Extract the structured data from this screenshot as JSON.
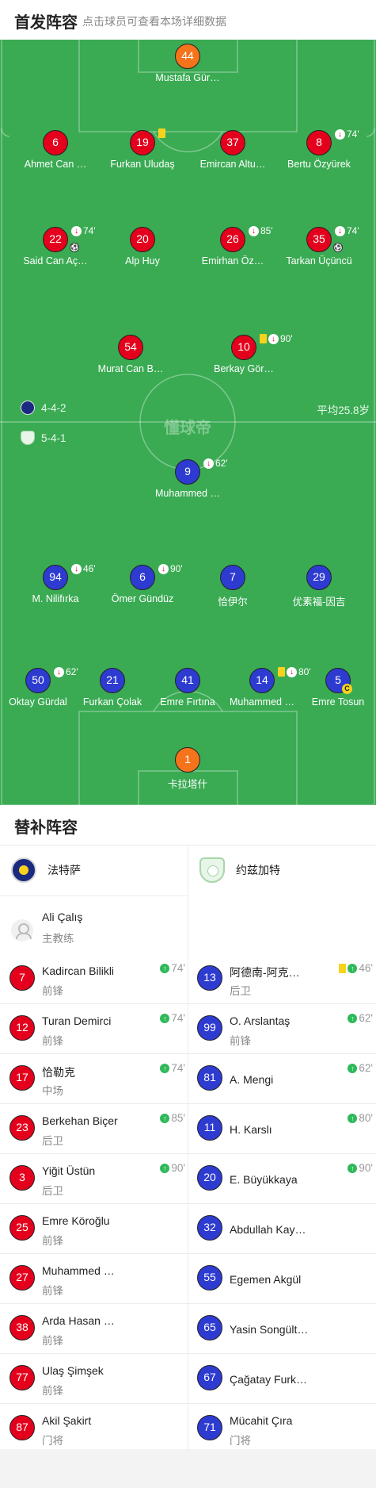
{
  "header": {
    "title": "首发阵容",
    "subtitle": "点击球员可查看本场详细数据"
  },
  "colors": {
    "home": "#e4001c",
    "away": "#2e3bd1",
    "goalkeeper": "#f5731a",
    "pitch": "#3aab53",
    "yellow_card": "#f8d21c",
    "sub_in": "#2fb95a"
  },
  "pitch": {
    "watermark": "懂球帝",
    "home_formation": "4-4-2",
    "away_formation": "5-4-1",
    "average_age": "平均25.8岁",
    "home_players": [
      {
        "number": "44",
        "name": "Mustafa Gür…",
        "role": "gk"
      },
      {
        "number": "6",
        "name": "Ahmet Can …"
      },
      {
        "number": "19",
        "name": "Furkan Uludaş",
        "yellow": true
      },
      {
        "number": "37",
        "name": "Emircan Altu…"
      },
      {
        "number": "8",
        "name": "Bertu Özyürek",
        "sub_out": "74'"
      },
      {
        "number": "22",
        "name": "Said Can Aç…",
        "sub_out": "74'",
        "goal": true
      },
      {
        "number": "20",
        "name": "Alp Huy"
      },
      {
        "number": "26",
        "name": "Emirhan Öz…",
        "sub_out": "85'"
      },
      {
        "number": "35",
        "name": "Tarkan Üçüncü",
        "sub_out": "74'",
        "goal": true
      },
      {
        "number": "54",
        "name": "Murat Can B…"
      },
      {
        "number": "10",
        "name": "Berkay Gör…",
        "yellow": true,
        "sub_out": "90'"
      }
    ],
    "away_players": [
      {
        "number": "9",
        "name": "Muhammed …",
        "sub_out": "62'"
      },
      {
        "number": "94",
        "name": "M. Nilifırka",
        "sub_out": "46'"
      },
      {
        "number": "6",
        "name": "Ömer Gündüz",
        "sub_out": "90'"
      },
      {
        "number": "7",
        "name": "恰伊尔"
      },
      {
        "number": "29",
        "name": "优素福-因吉"
      },
      {
        "number": "50",
        "name": "Oktay Gürdal",
        "sub_out": "62'"
      },
      {
        "number": "21",
        "name": "Furkan Çolak"
      },
      {
        "number": "41",
        "name": "Emre Fırtına"
      },
      {
        "number": "14",
        "name": "Muhammed …",
        "yellow": true,
        "sub_out": "80'"
      },
      {
        "number": "5",
        "name": "Emre Tosun",
        "captain": "C"
      },
      {
        "number": "1",
        "name": "卡拉塔什",
        "role": "gk"
      }
    ]
  },
  "subs": {
    "title": "替补阵容",
    "home_team": "法特萨",
    "away_team": "约兹加特",
    "home_coach": {
      "name": "Ali Çalış",
      "role": "主教练"
    },
    "home": [
      {
        "number": "7",
        "name": "Kadircan Bilikli",
        "pos": "前锋",
        "sub_in": "74'"
      },
      {
        "number": "12",
        "name": "Turan Demirci",
        "pos": "前锋",
        "sub_in": "74'"
      },
      {
        "number": "17",
        "name": "恰勒克",
        "pos": "中场",
        "sub_in": "74'"
      },
      {
        "number": "23",
        "name": "Berkehan Biçer",
        "pos": "后卫",
        "sub_in": "85'"
      },
      {
        "number": "3",
        "name": "Yiğit Üstün",
        "pos": "后卫",
        "sub_in": "90'"
      },
      {
        "number": "25",
        "name": "Emre Köroğlu",
        "pos": "前锋"
      },
      {
        "number": "27",
        "name": "Muhammed …",
        "pos": "前锋"
      },
      {
        "number": "38",
        "name": "Arda Hasan …",
        "pos": "前锋"
      },
      {
        "number": "77",
        "name": "Ulaş Şimşek",
        "pos": "前锋"
      },
      {
        "number": "87",
        "name": "Akil Şakirt",
        "pos": "门将"
      }
    ],
    "away": [
      {
        "number": "13",
        "name": "阿德南-阿克…",
        "pos": "后卫",
        "sub_in": "46'",
        "yellow": true
      },
      {
        "number": "99",
        "name": "O. Arslantaş",
        "pos": "前锋",
        "sub_in": "62'"
      },
      {
        "number": "81",
        "name": "A. Mengi",
        "pos": "",
        "sub_in": "62'"
      },
      {
        "number": "11",
        "name": "H. Karslı",
        "pos": "",
        "sub_in": "80'"
      },
      {
        "number": "20",
        "name": "E. Büyükkaya",
        "pos": "",
        "sub_in": "90'"
      },
      {
        "number": "32",
        "name": "Abdullah Kay…",
        "pos": ""
      },
      {
        "number": "55",
        "name": "Egemen Akgül",
        "pos": ""
      },
      {
        "number": "65",
        "name": "Yasin Songült…",
        "pos": ""
      },
      {
        "number": "67",
        "name": "Çağatay Furk…",
        "pos": ""
      },
      {
        "number": "71",
        "name": "Mücahit Çıra",
        "pos": "门将"
      }
    ]
  }
}
